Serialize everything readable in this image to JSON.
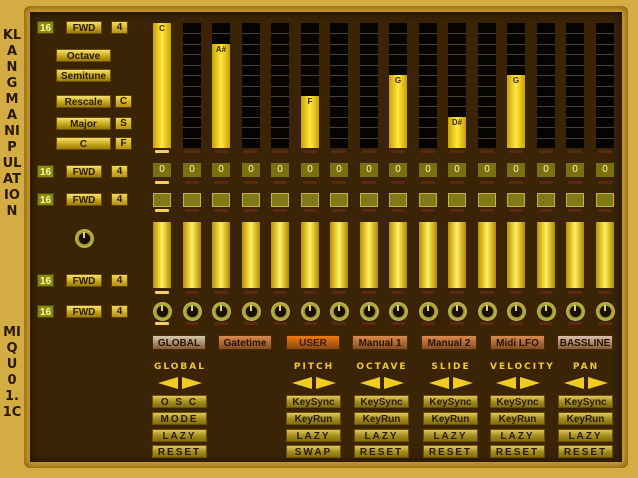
{
  "title_vertical": "KLANGMANIPULATION",
  "version_vertical": "MIQU 01.1C",
  "left": {
    "rows": [
      {
        "steps": "16",
        "direction": "FWD",
        "div": "4"
      },
      {
        "steps": "16",
        "direction": "FWD",
        "div": "4"
      },
      {
        "steps": "16",
        "direction": "FWD",
        "div": "4"
      },
      {
        "steps": "16",
        "direction": "FWD",
        "div": "4"
      },
      {
        "steps": "16",
        "direction": "FWD",
        "div": "4"
      }
    ],
    "octave": "Octave",
    "semitune": "Semitune",
    "rescale": "Rescale",
    "rescale_flag": "C",
    "scale": "Major",
    "scale_flag": "S",
    "root": "C",
    "root_flag": "F"
  },
  "pitch": {
    "max_steps": 12,
    "values": [
      12,
      0,
      10,
      0,
      0,
      5,
      0,
      0,
      7,
      0,
      3,
      0,
      7,
      0,
      0,
      0
    ],
    "notes": [
      "C",
      "",
      "A#",
      "",
      "",
      "F",
      "",
      "",
      "G",
      "",
      "D#",
      "",
      "G",
      "",
      "",
      ""
    ]
  },
  "values": [
    "0",
    "0",
    "0",
    "0",
    "0",
    "0",
    "0",
    "0",
    "0",
    "0",
    "0",
    "0",
    "0",
    "0",
    "0",
    "0"
  ],
  "active_step": 0,
  "tabs": [
    {
      "label": "GLOBAL",
      "color": "#d8c8b0"
    },
    {
      "label": "Gatetime",
      "color": "#d88a50"
    },
    {
      "label": "USER",
      "color": "#f07a10"
    },
    {
      "label": "Manual 1",
      "color": "#d88a50"
    },
    {
      "label": "Manual 2",
      "color": "#d88a50"
    },
    {
      "label": "Midi LFO",
      "color": "#d88a50"
    },
    {
      "label": "BASSLINE",
      "color": "#d8c0b0"
    }
  ],
  "groups": [
    {
      "title": "GLOBAL",
      "buttons": [
        "O S C",
        "MODE",
        "LAZY",
        "RESET"
      ]
    },
    {
      "title": "PITCH",
      "buttons": [
        "KeySync",
        "KeyRun",
        "LAZY",
        "SWAP"
      ]
    },
    {
      "title": "OCTAVE",
      "buttons": [
        "KeySync",
        "KeyRun",
        "LAZY",
        "RESET"
      ]
    },
    {
      "title": "SLIDE",
      "buttons": [
        "KeySync",
        "KeyRun",
        "LAZY",
        "RESET"
      ]
    },
    {
      "title": "VELOCITY",
      "buttons": [
        "KeySync",
        "KeyRun",
        "LAZY",
        "RESET"
      ]
    },
    {
      "title": "PAN",
      "buttons": [
        "KeySync",
        "KeyRun",
        "LAZY",
        "RESET"
      ]
    }
  ]
}
